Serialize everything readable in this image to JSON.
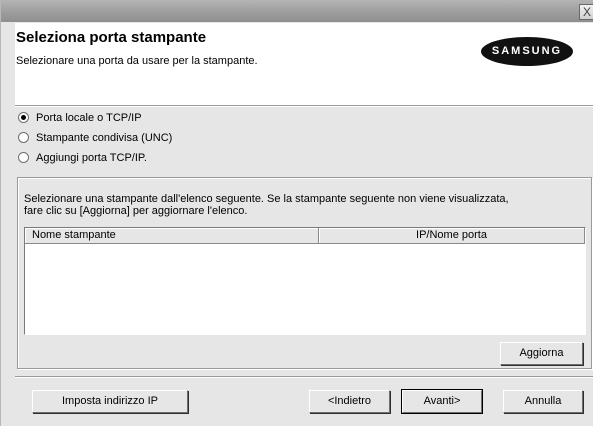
{
  "window": {
    "close_glyph": "X"
  },
  "header": {
    "title": "Seleziona porta stampante",
    "subtitle": "Selezionare una porta da usare per la stampante.",
    "logo_text": "SAMSUNG"
  },
  "port_options": [
    {
      "label": "Porta locale o TCP/IP",
      "checked": true
    },
    {
      "label": "Stampante condivisa (UNC)",
      "checked": false
    },
    {
      "label": "Aggiungi porta TCP/IP.",
      "checked": false
    }
  ],
  "printer_list": {
    "instructions_line1": "Selezionare una stampante dall'elenco seguente. Se la stampante seguente non viene visualizzata,",
    "instructions_line2": "fare clic su [Aggiorna] per aggiornare l'elenco.",
    "columns": [
      "Nome stampante",
      "IP/Nome porta"
    ],
    "rows": []
  },
  "buttons": {
    "refresh": "Aggiorna",
    "set_ip": "Imposta indirizzo IP",
    "back": "<Indietro",
    "next": "Avanti>",
    "cancel": "Annulla"
  }
}
